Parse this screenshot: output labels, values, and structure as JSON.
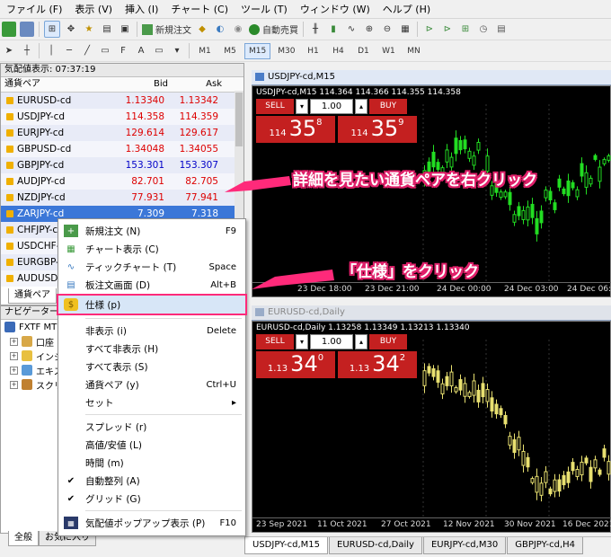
{
  "menubar": [
    "ファイル (F)",
    "表示 (V)",
    "挿入 (I)",
    "チャート (C)",
    "ツール (T)",
    "ウィンドウ (W)",
    "ヘルプ (H)"
  ],
  "toolbar": {
    "new_order": "新規注文",
    "auto_trade": "自動売買",
    "timeframes": [
      "M1",
      "M5",
      "M15",
      "M30",
      "H1",
      "H4",
      "D1",
      "W1",
      "MN"
    ],
    "selected_timeframe": "M15"
  },
  "market_watch": {
    "title": "気配値表示: 07:37:19",
    "col_symbol": "通貨ペア",
    "col_bid": "Bid",
    "col_ask": "Ask",
    "rows": [
      {
        "symbol": "EURUSD-cd",
        "bid": "1.13340",
        "ask": "1.13342",
        "color": "red"
      },
      {
        "symbol": "USDJPY-cd",
        "bid": "114.358",
        "ask": "114.359",
        "color": "red"
      },
      {
        "symbol": "EURJPY-cd",
        "bid": "129.614",
        "ask": "129.617",
        "color": "red"
      },
      {
        "symbol": "GBPUSD-cd",
        "bid": "1.34048",
        "ask": "1.34055",
        "color": "red"
      },
      {
        "symbol": "GBPJPY-cd",
        "bid": "153.301",
        "ask": "153.307",
        "color": "blue"
      },
      {
        "symbol": "AUDJPY-cd",
        "bid": "82.701",
        "ask": "82.705",
        "color": "red"
      },
      {
        "symbol": "NZDJPY-cd",
        "bid": "77.931",
        "ask": "77.941",
        "color": "red"
      },
      {
        "symbol": "ZARJPY-cd",
        "bid": "7.309",
        "ask": "7.318",
        "color": "sel"
      },
      {
        "symbol": "CHFJPY-c",
        "bid": "",
        "ask": "",
        "color": "red"
      },
      {
        "symbol": "USDCHF-",
        "bid": "",
        "ask": "",
        "color": "red"
      },
      {
        "symbol": "EURGBP-",
        "bid": "",
        "ask": "",
        "color": "red"
      },
      {
        "symbol": "AUDUSD",
        "bid": "",
        "ask": "",
        "color": "red"
      }
    ],
    "tab": "通貨ペア"
  },
  "navigator": {
    "title": "ナビゲーター",
    "items": [
      "FXTF MT",
      "口座",
      "インジ",
      "エキス",
      "スクリ"
    ],
    "tabs": [
      "全般",
      "お気に入り"
    ]
  },
  "chart1": {
    "title": "USDJPY-cd,M15",
    "info": "USDJPY-cd,M15  114.364 114.366 114.355 114.358",
    "lot": "1.00",
    "sell": "SELL",
    "buy": "BUY",
    "sell_price": {
      "p1": "114",
      "p2": "35",
      "p3": "8"
    },
    "buy_price": {
      "p1": "114",
      "p2": "35",
      "p3": "9"
    },
    "xlabels": [
      "23 Dec 18:00",
      "23 Dec 21:00",
      "24 Dec 00:00",
      "24 Dec 03:00",
      "24 Dec 06:00"
    ]
  },
  "chart2": {
    "title": "EURUSD-cd,Daily",
    "info": "EURUSD-cd,Daily  1.13258 1.13349 1.13213 1.13340",
    "lot": "1.00",
    "sell": "SELL",
    "buy": "BUY",
    "sell_price": {
      "p1": "1.13",
      "p2": "34",
      "p3": "0"
    },
    "buy_price": {
      "p1": "1.13",
      "p2": "34",
      "p3": "2"
    },
    "xlabels": [
      "23 Sep 2021",
      "11 Oct 2021",
      "27 Oct 2021",
      "12 Nov 2021",
      "30 Nov 2021",
      "16 Dec 2021"
    ]
  },
  "chart_tabs": [
    "USDJPY-cd,M15",
    "EURUSD-cd,Daily",
    "EURJPY-cd,M30",
    "GBPJPY-cd,H4"
  ],
  "context_menu": {
    "items": [
      {
        "label": "新規注文 (N)",
        "key": "F9",
        "icon": "new-order-icon"
      },
      {
        "label": "チャート表示 (C)",
        "key": "",
        "icon": "chart-icon"
      },
      {
        "label": "ティックチャート (T)",
        "key": "Space",
        "icon": "tick-chart-icon"
      },
      {
        "label": "板注文画面 (D)",
        "key": "Alt+B",
        "icon": "depth-icon"
      },
      {
        "label": "仕様 (p)",
        "key": "",
        "icon": "spec-icon",
        "highlight": true
      },
      {
        "label": "非表示 (i)",
        "key": "Delete",
        "icon": ""
      },
      {
        "label": "すべて非表示 (H)",
        "key": "",
        "icon": ""
      },
      {
        "label": "すべて表示 (S)",
        "key": "",
        "icon": ""
      },
      {
        "label": "通貨ペア (y)",
        "key": "Ctrl+U",
        "icon": ""
      },
      {
        "label": "セット",
        "key": "▸",
        "icon": ""
      },
      {
        "label": "スプレッド (r)",
        "key": "",
        "icon": ""
      },
      {
        "label": "高値/安値 (L)",
        "key": "",
        "icon": ""
      },
      {
        "label": "時間 (m)",
        "key": "",
        "icon": ""
      },
      {
        "label": "自動整列 (A)",
        "key": "",
        "icon": "check-icon"
      },
      {
        "label": "グリッド (G)",
        "key": "",
        "icon": "check-icon"
      },
      {
        "label": "気配値ポップアップ表示 (P)",
        "key": "F10",
        "icon": "popup-icon"
      }
    ]
  },
  "annotations": {
    "right_click": "詳細を見たい通貨ペアを右クリック",
    "click_spec": "「仕様」をクリック"
  },
  "colors": {
    "accent": "#ff2a7a",
    "sell": "#c42020",
    "selected_row": "#3b77d8"
  }
}
